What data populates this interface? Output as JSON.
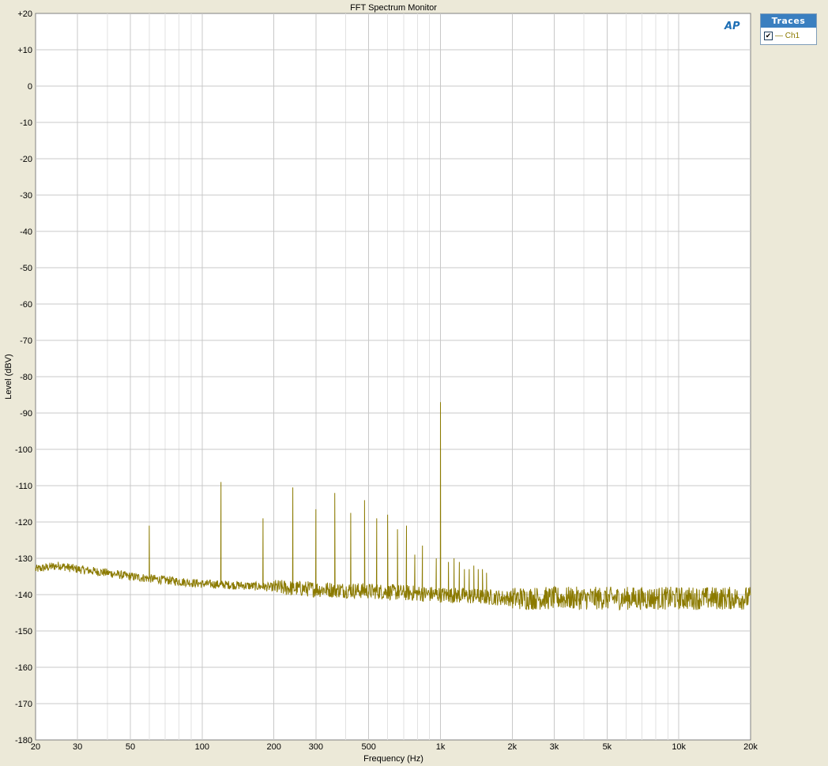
{
  "window": {
    "title": "FFT Spectrum Monitor"
  },
  "traces_panel": {
    "header": "Traces",
    "items": [
      {
        "label": "— Ch1",
        "checked": true,
        "color": "#8b7a00"
      }
    ]
  },
  "logo": {
    "text": "AP"
  },
  "chart_data": {
    "type": "line",
    "title": "FFT Spectrum Monitor",
    "xlabel": "Frequency (Hz)",
    "ylabel": "Level (dBV)",
    "xscale": "log",
    "xlim": [
      20,
      20000
    ],
    "ylim": [
      -180,
      20
    ],
    "x_ticks": [
      20,
      30,
      50,
      100,
      200,
      300,
      500,
      1000,
      2000,
      3000,
      5000,
      10000,
      20000
    ],
    "x_tick_labels": [
      "20",
      "30",
      "50",
      "100",
      "200",
      "300",
      "500",
      "1k",
      "2k",
      "3k",
      "5k",
      "10k",
      "20k"
    ],
    "y_ticks": [
      20,
      10,
      0,
      -10,
      -20,
      -30,
      -40,
      -50,
      -60,
      -70,
      -80,
      -90,
      -100,
      -110,
      -120,
      -130,
      -140,
      -150,
      -160,
      -170,
      -180
    ],
    "y_tick_labels": [
      "+20",
      "+10",
      "0",
      "-10",
      "-20",
      "-30",
      "-40",
      "-50",
      "-60",
      "-70",
      "-80",
      "-90",
      "-100",
      "-110",
      "-120",
      "-130",
      "-140",
      "-150",
      "-160",
      "-170",
      "-180"
    ],
    "grid": true,
    "legend": "top-right",
    "series": [
      {
        "name": "Ch1",
        "color": "#8b7a00",
        "noise_floor": [
          [
            20,
            -133
          ],
          [
            25,
            -132
          ],
          [
            30,
            -133
          ],
          [
            40,
            -134
          ],
          [
            50,
            -135
          ],
          [
            70,
            -136
          ],
          [
            100,
            -137
          ],
          [
            150,
            -137.5
          ],
          [
            200,
            -138
          ],
          [
            300,
            -138.5
          ],
          [
            500,
            -139
          ],
          [
            1000,
            -140
          ],
          [
            2000,
            -141
          ],
          [
            5000,
            -141
          ],
          [
            10000,
            -141
          ],
          [
            20000,
            -141
          ]
        ],
        "peaks": [
          [
            60,
            -121
          ],
          [
            120,
            -109
          ],
          [
            180,
            -119
          ],
          [
            240,
            -110.5
          ],
          [
            300,
            -116.5
          ],
          [
            360,
            -112
          ],
          [
            420,
            -117.5
          ],
          [
            480,
            -114
          ],
          [
            540,
            -119
          ],
          [
            600,
            -118
          ],
          [
            660,
            -122
          ],
          [
            720,
            -121
          ],
          [
            780,
            -129
          ],
          [
            840,
            -126.5
          ],
          [
            960,
            -130
          ],
          [
            1000,
            -87
          ],
          [
            1080,
            -131
          ],
          [
            1140,
            -130
          ],
          [
            1200,
            -131
          ],
          [
            1260,
            -133
          ],
          [
            1320,
            -133
          ],
          [
            1380,
            -132
          ],
          [
            1440,
            -133
          ],
          [
            1500,
            -133
          ],
          [
            1560,
            -134
          ]
        ]
      }
    ]
  }
}
